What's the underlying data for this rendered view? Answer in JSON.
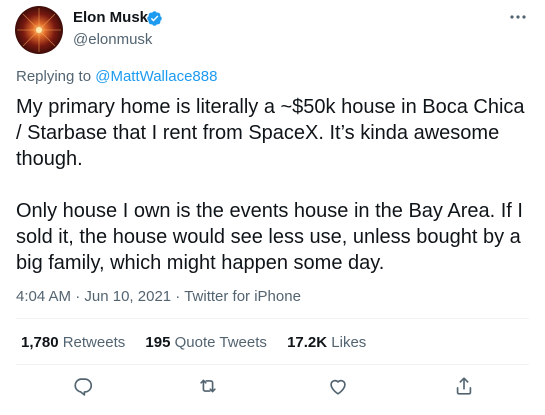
{
  "author": {
    "name": "Elon Musk",
    "handle": "@elonmusk",
    "verified": true,
    "avatar": "avatar-image"
  },
  "reply": {
    "prefix": "Replying to ",
    "mention": "@MattWallace888"
  },
  "tweet": {
    "text": "My primary home is literally a ~$50k house in Boca Chica / Starbase that I rent from SpaceX. It’s kinda awesome though.\n\nOnly house I own is the events house in the Bay Area. If I sold it, the house would see less use, unless bought by a big family, which might happen some day."
  },
  "meta": {
    "time": "4:04 AM",
    "separator1": " · ",
    "date": "Jun 10, 2021",
    "separator2": " · ",
    "source": "Twitter for iPhone"
  },
  "stats": {
    "retweets_count": "1,780",
    "retweets_label": "Retweets",
    "quotes_count": "195",
    "quotes_label": "Quote Tweets",
    "likes_count": "17.2K",
    "likes_label": "Likes"
  },
  "icons": {
    "more": "more-icon",
    "reply": "reply-icon",
    "retweet": "retweet-icon",
    "like": "like-icon",
    "share": "share-icon",
    "verified": "verified-badge-icon"
  },
  "colors": {
    "accent": "#1d9bf0",
    "text": "#0f1419",
    "muted": "#536471"
  }
}
